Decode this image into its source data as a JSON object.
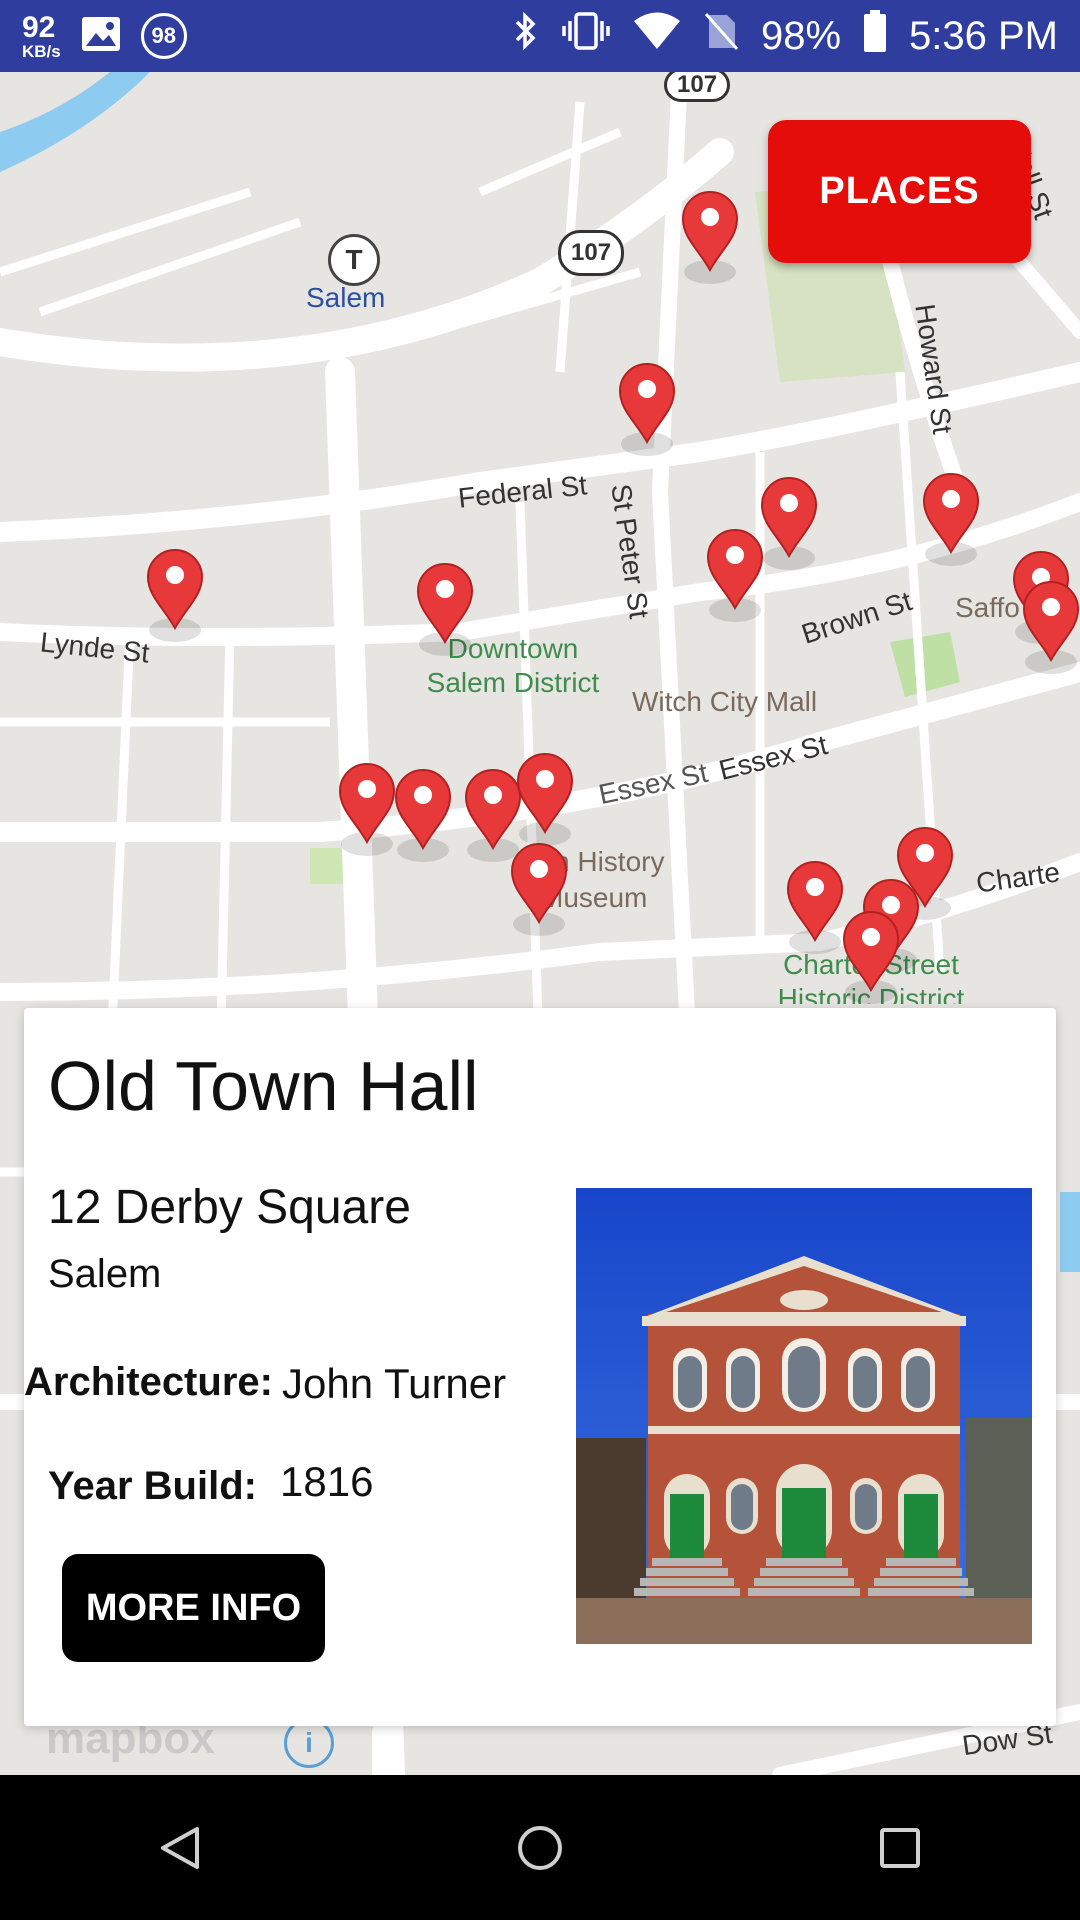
{
  "status_bar": {
    "speed_value": "92",
    "speed_unit": "KB/s",
    "notification_badge": "98",
    "battery": "98%",
    "time": "5:36 PM",
    "icons": [
      "image-icon",
      "bluetooth-icon",
      "vibrate-icon",
      "wifi-icon",
      "no-sim-icon",
      "battery-icon"
    ]
  },
  "map": {
    "labels": {
      "salem_station": "Salem",
      "route_107": "107",
      "route_107_top": "107",
      "federal_st": "Federal St",
      "lynde_st": "Lynde St",
      "st_peter_st": "St Peter St",
      "howard_st": "Howard St",
      "brown_st": "Brown St",
      "downtown": "Downtown Salem District",
      "witch_city_mall": "Witch City Mall",
      "essex_st_1": "Essex St",
      "essex_st_2": "Essex St",
      "history_museum": "ch History Museum",
      "charter_street": "Charter Street Historic District",
      "charter": "Charte",
      "dow_st": "Dow St",
      "mall_st": "Mall St",
      "saffo": "Saffo",
      "mapbox": "mapbox"
    },
    "colors": {
      "background": "#e7e5e2",
      "road": "#ffffff",
      "park": "#cfe0b5",
      "pin": "#e8393a",
      "water": "#8ecbf0"
    }
  },
  "places_button": {
    "label": "PLACES"
  },
  "card": {
    "title": "Old Town Hall",
    "address": "12 Derby Square",
    "city": "Salem",
    "architecture_label": "Architecture:",
    "architecture_value": "John Turner",
    "year_label": "Year Build:",
    "year_value": "1816",
    "more_info_label": "MORE INFO"
  },
  "nav": {
    "back": "back-icon",
    "home": "home-icon",
    "recents": "recents-icon"
  }
}
